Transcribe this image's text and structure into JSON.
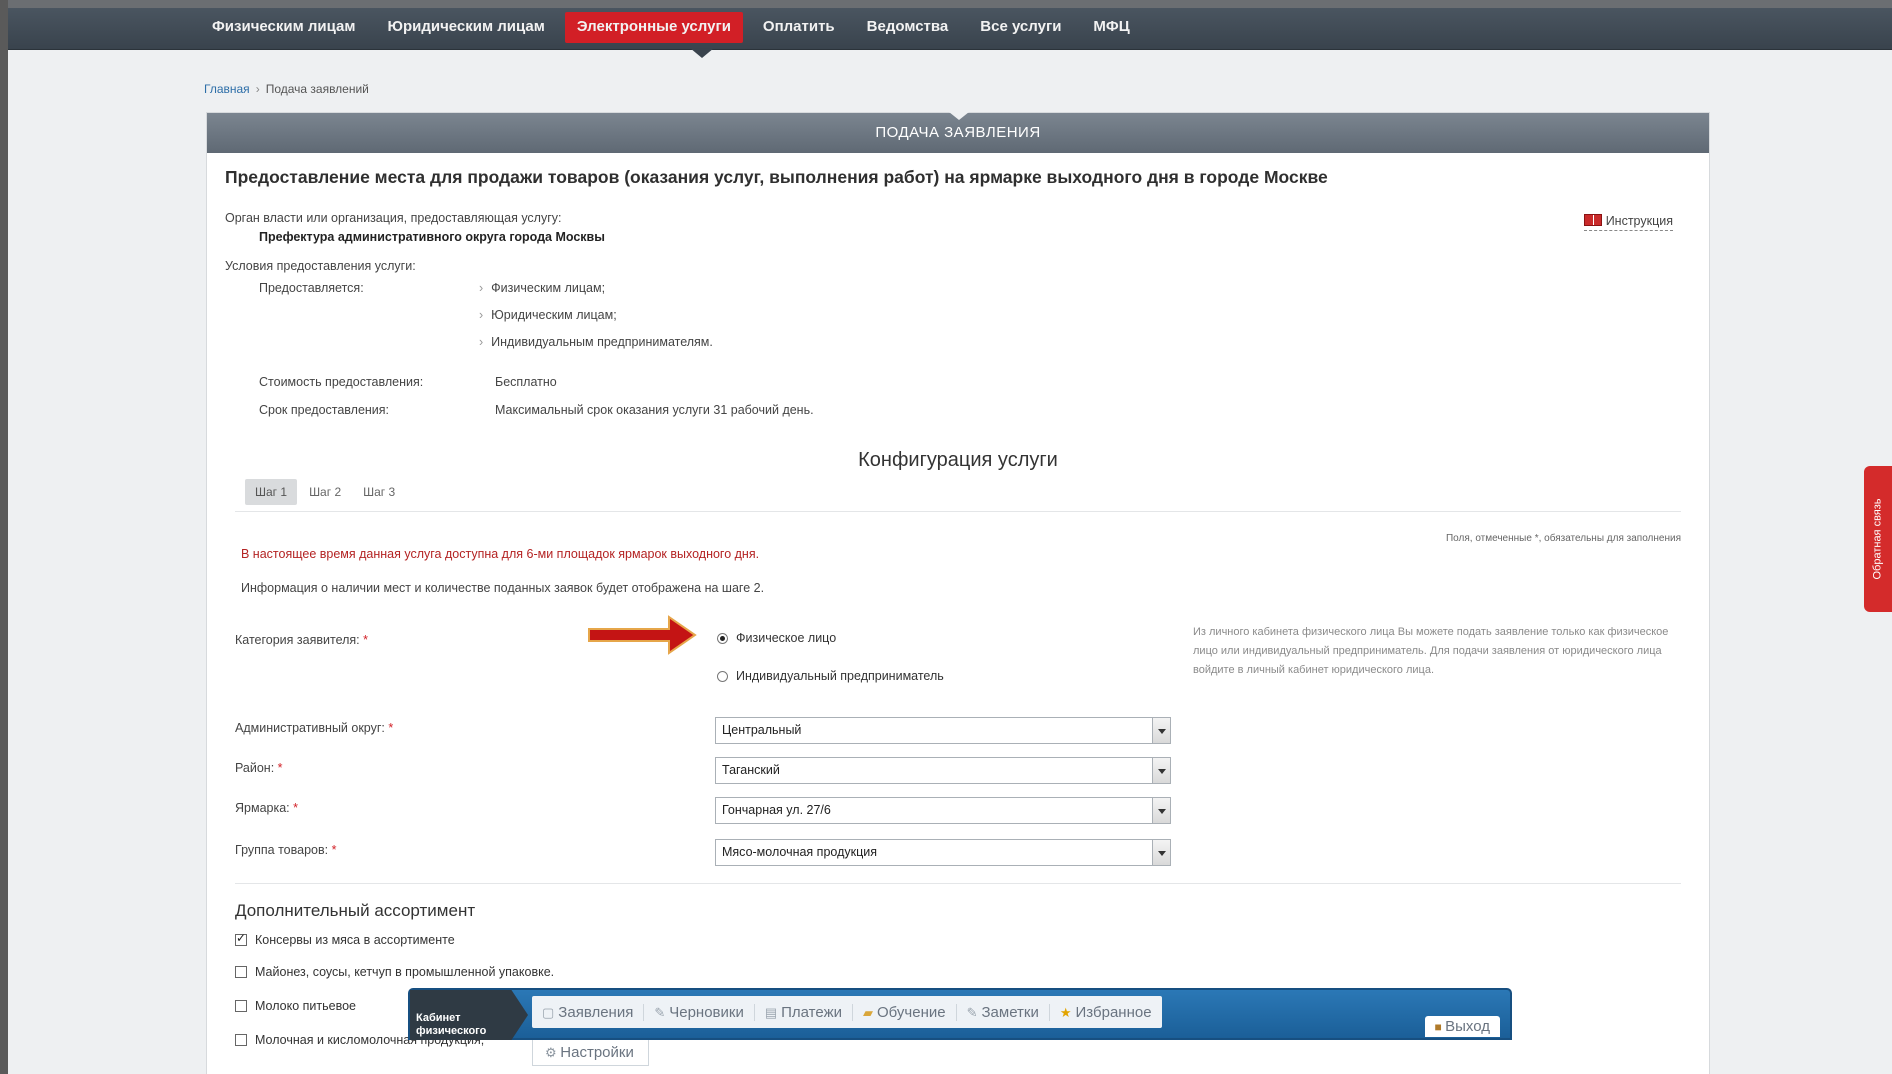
{
  "nav": {
    "items": [
      "Физическим лицам",
      "Юридическим лицам",
      "Электронные услуги",
      "Оплатить",
      "Ведомства",
      "Все услуги",
      "МФЦ"
    ],
    "active_index": 2
  },
  "breadcrumb": {
    "home": "Главная",
    "current": "Подача заявлений"
  },
  "panel": {
    "header": "ПОДАЧА ЗАЯВЛЕНИЯ",
    "service_title": "Предоставление места для продажи товаров (оказания услуг, выполнения работ) на ярмарке выходного дня в городе Москве",
    "org_label": "Орган власти или организация, предоставляющая услугу:",
    "org_value": "Префектура административного округа города Москвы",
    "instructions": "Инструкция",
    "conditions_label": "Условия предоставления услуги:",
    "provided_label": "Предоставляется:",
    "provided_list": [
      "Физическим лицам;",
      "Юридическим лицам;",
      "Индивидуальным предпринимателям."
    ],
    "cost_label": "Стоимость предоставления:",
    "cost_value": "Бесплатно",
    "term_label": "Срок предоставления:",
    "term_value": "Максимальный срок оказания услуги 31 рабочий день."
  },
  "config": {
    "title": "Конфигурация услуги",
    "steps": [
      "Шаг 1",
      "Шаг 2",
      "Шаг 3"
    ],
    "required_note": "Поля, отмеченные *, обязательны для заполнения",
    "notice_red": "В настоящее время данная услуга доступна для 6-ми площадок ярмарок выходного дня.",
    "notice_info": "Информация о наличии мест и количестве поданных заявок будет отображена на шаге 2.",
    "category_label": "Категория заявителя:",
    "category_options": [
      "Физическое лицо",
      "Индивидуальный предприниматель"
    ],
    "category_selected": 0,
    "hint": "Из личного кабинета физического лица Вы можете подать заявление только как физическое лицо или индивидуальный предприниматель. Для подачи заявления от юридического лица войдите в личный кабинет юридического лица.",
    "district_label": "Административный округ:",
    "district_value": "Центральный",
    "area_label": "Район:",
    "area_value": "Таганский",
    "fair_label": "Ярмарка:",
    "fair_value": "Гончарная ул. 27/6",
    "group_label": "Группа товаров:",
    "group_value": "Мясо-молочная продукция",
    "required_mark": "*"
  },
  "additional": {
    "title": "Дополнительный ассортимент",
    "items": [
      {
        "label": "Консервы из мяса в ассортименте",
        "checked": true
      },
      {
        "label": "Майонез, соусы, кетчуп в промышленной упаковке.",
        "checked": false
      },
      {
        "label": "Молоко питьевое",
        "checked": false
      },
      {
        "label": "Молочная и кисломолочная продукция;",
        "checked": false
      }
    ]
  },
  "cabinet": {
    "label": "Кабинет физического",
    "tabs": [
      {
        "label": "Заявления",
        "icon": "document-icon"
      },
      {
        "label": "Черновики",
        "icon": "pencil-icon"
      },
      {
        "label": "Платежи",
        "icon": "payment-icon"
      },
      {
        "label": "Обучение",
        "icon": "folder-icon"
      },
      {
        "label": "Заметки",
        "icon": "note-icon"
      },
      {
        "label": "Избранное",
        "icon": "star-icon"
      }
    ],
    "exit": "Выход",
    "settings": "Настройки"
  },
  "feedback": "Обратная связь",
  "colors": {
    "accent_red": "#d21f26",
    "nav_bg": "#39434d",
    "cabinet_blue": "#1b5f98"
  }
}
